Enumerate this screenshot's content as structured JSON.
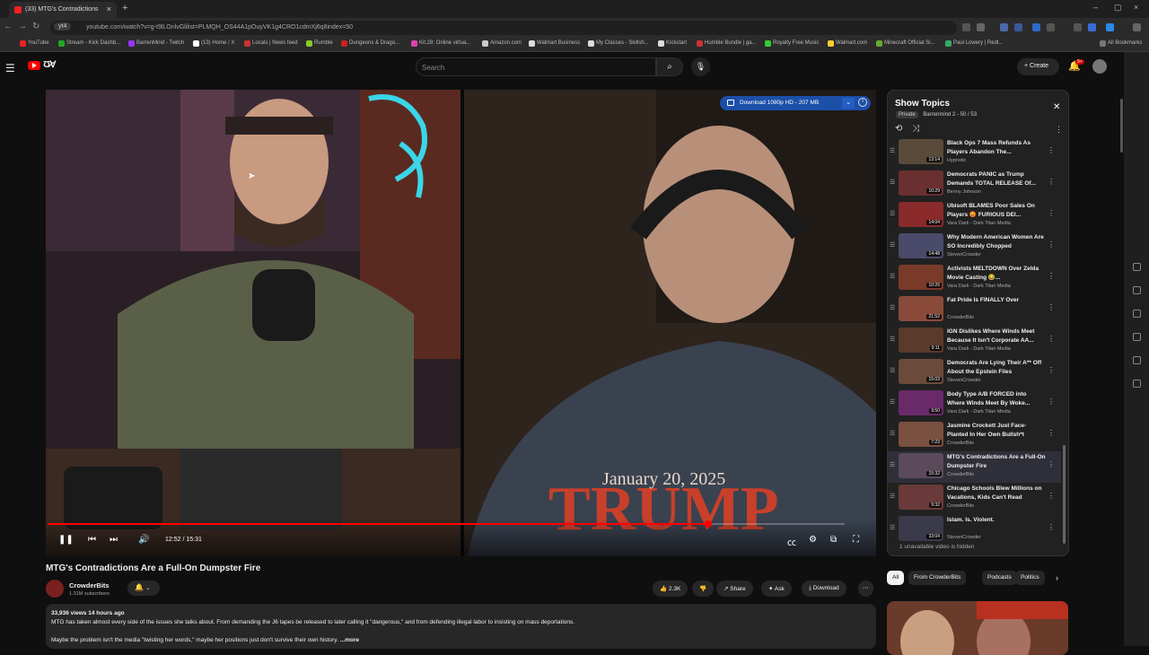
{
  "browser": {
    "tab_title": "(33) MTG's Contradictions",
    "url": "youtube.com/watch?v=g-t9lLOnlvGlilist=PLMQH_OS44A1pOuyVK1g4CRO1cdmXj6q8index=50",
    "site_chip": "yt4",
    "bookmarks": [
      "YouTube",
      "Stream - Kick Dashb...",
      "BarrenMind - Twitch",
      "(13) Home / X",
      "Locals | News feed",
      "Rumble",
      "Dungeons & Drago...",
      "Kit.28: Online virtua...",
      "Amazon.com",
      "Walmart Business",
      "My Classes - Skillsh...",
      "Kickstart",
      "Humble Bundle | ga...",
      "Royalty Free Music",
      "Walmart.com",
      "Minecraft Official Si...",
      "Paul Lowery | Redl...",
      "All Bookmarks"
    ]
  },
  "header": {
    "search_placeholder": "Search",
    "create_label": "Create",
    "notif_count": "9+"
  },
  "player": {
    "download_label": "Download 1080p HD - 207 MB",
    "time": "12:52 / 15:31",
    "progress_fraction": 0.829
  },
  "video": {
    "title": "MTG's Contradictions Are a Full-On Dumpster Fire",
    "channel": "CrowderBits",
    "subscribers": "1.31M subscribers",
    "likes": "2.3K",
    "share_label": "Share",
    "ask_label": "Ask",
    "download_label": "Download",
    "views_time": "33,936 views  14 hours ago",
    "desc_line1": "MTG has taken almost every side of the issues she talks about. From demanding the J6 tapes be released to later calling it \"dangerous,\" and from defending illegal labor to insisting on mass deportations.",
    "desc_line2": "Maybe the problem isn't the media \"twisting her words,\" maybe her positions just don't survive their own history.",
    "more_label": "...more"
  },
  "playlist": {
    "title": "Show Topics",
    "privacy": "Private",
    "owner_count": "Barrenmind 2 - 50 / 53",
    "hidden_note": "1 unavailable video is hidden",
    "items": [
      {
        "title": "Black Ops 7 Mass Refunds As Players Abandon The...",
        "channel": "Hypnotic",
        "duration": "13:14",
        "color": "#5a4a3a"
      },
      {
        "title": "Democrats PANIC as Trump Demands TOTAL RELEASE Of...",
        "channel": "Benny Johnson",
        "duration": "10:29",
        "color": "#6a3030"
      },
      {
        "title": "Ubisoft BLAMES Poor Sales On Players 😡 FURIOUS DEI...",
        "channel": "Vara Dark - Dark Titan Media",
        "duration": "14:04",
        "color": "#8a2a2a"
      },
      {
        "title": "Why Modern American Women Are SO Incredibly Chopped",
        "channel": "StevenCrowder",
        "duration": "14:48",
        "color": "#4a4a6a"
      },
      {
        "title": "Activists MELTDOWN Over Zelda Movie Casting 😂...",
        "channel": "Vara Dark - Dark Titan Media",
        "duration": "10:26",
        "color": "#7a3a2a"
      },
      {
        "title": "Fat Pride Is FINALLY Over",
        "channel": "CrowderBits",
        "duration": "21:52",
        "color": "#8a4a3a"
      },
      {
        "title": "IGN Dislikes Where Winds Meet Because It Isn't Corporate AA...",
        "channel": "Vara Dark - Dark Titan Media",
        "duration": "9:11",
        "color": "#5a3a2a"
      },
      {
        "title": "Democrats Are Lying Their A** Off About the Epstein Files",
        "channel": "StevenCrowder",
        "duration": "15:03",
        "color": "#6a4a3a"
      },
      {
        "title": "Body Type A/B FORCED into Where Winds Meet By Woke...",
        "channel": "Vara Dark - Dark Titan Media",
        "duration": "9:50",
        "color": "#6a2a6a"
      },
      {
        "title": "Jasmine Crockett Just Face-Planted In Her Own Bullsh*t",
        "channel": "CrowderBits",
        "duration": "7:23",
        "color": "#7a5040"
      },
      {
        "title": "MTG's Contradictions Are a Full-On Dumpster Fire",
        "channel": "CrowderBits",
        "duration": "15:32",
        "color": "#5a4a5a"
      },
      {
        "title": "Chicago Schools Blew Millions on Vacations, Kids Can't Read",
        "channel": "CrowderBits",
        "duration": "9:32",
        "color": "#6a3a3a"
      },
      {
        "title": "Islam. Is. Violent.",
        "channel": "StevenCrowder",
        "duration": "33:04",
        "color": "#3a3a4a"
      }
    ]
  },
  "chips": [
    "All",
    "From CrowderBits",
    "Podcasts",
    "Politics"
  ],
  "colors": {
    "accent": "#ff0000",
    "download_blue": "#1b4fa8"
  }
}
